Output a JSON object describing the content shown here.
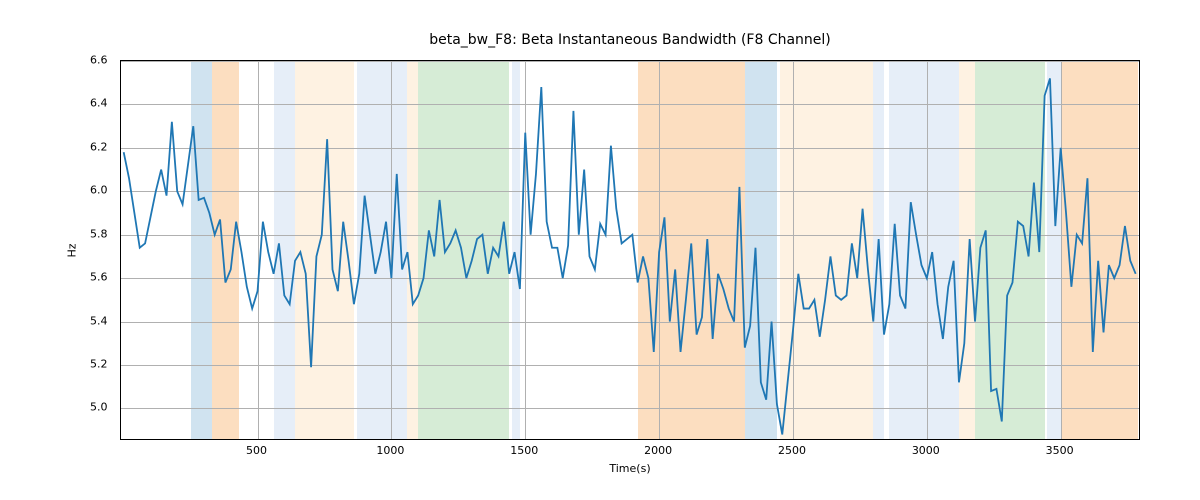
{
  "chart_data": {
    "type": "line",
    "title": "beta_bw_F8: Beta Instantaneous Bandwidth (F8 Channel)",
    "xlabel": "Time(s)",
    "ylabel": "Hz",
    "xlim": [
      -10,
      3800
    ],
    "ylim": [
      4.85,
      6.6
    ],
    "xticks": [
      500,
      1000,
      1500,
      2000,
      2500,
      3000,
      3500
    ],
    "yticks": [
      5.0,
      5.2,
      5.4,
      5.6,
      5.8,
      6.0,
      6.2,
      6.4,
      6.6
    ],
    "line_color": "#1f77b4",
    "bands": [
      {
        "x0": 250,
        "x1": 330,
        "color": "#d0e3f0"
      },
      {
        "x0": 330,
        "x1": 430,
        "color": "#fcdec0"
      },
      {
        "x0": 560,
        "x1": 640,
        "color": "#e6eef8"
      },
      {
        "x0": 640,
        "x1": 860,
        "color": "#fef2e2"
      },
      {
        "x0": 870,
        "x1": 1060,
        "color": "#e6eef8"
      },
      {
        "x0": 1060,
        "x1": 1100,
        "color": "#fef2e2"
      },
      {
        "x0": 1100,
        "x1": 1440,
        "color": "#d6ecd6"
      },
      {
        "x0": 1450,
        "x1": 1480,
        "color": "#e6eef8"
      },
      {
        "x0": 1920,
        "x1": 2320,
        "color": "#fcdec0"
      },
      {
        "x0": 2320,
        "x1": 2440,
        "color": "#d0e3f0"
      },
      {
        "x0": 2450,
        "x1": 2800,
        "color": "#fef2e2"
      },
      {
        "x0": 2800,
        "x1": 2840,
        "color": "#e6eef8"
      },
      {
        "x0": 2860,
        "x1": 3120,
        "color": "#e6eef8"
      },
      {
        "x0": 3120,
        "x1": 3180,
        "color": "#fef2e2"
      },
      {
        "x0": 3180,
        "x1": 3440,
        "color": "#d6ecd6"
      },
      {
        "x0": 3450,
        "x1": 3500,
        "color": "#e6eef8"
      },
      {
        "x0": 3500,
        "x1": 3790,
        "color": "#fcdec0"
      }
    ],
    "series": [
      {
        "name": "beta_bw_F8",
        "x_step": 20,
        "x_start": 0,
        "values": [
          6.18,
          6.06,
          5.9,
          5.74,
          5.76,
          5.88,
          6.0,
          6.1,
          5.98,
          6.32,
          6.0,
          5.94,
          6.12,
          6.3,
          5.96,
          5.97,
          5.9,
          5.8,
          5.87,
          5.58,
          5.64,
          5.86,
          5.72,
          5.56,
          5.46,
          5.54,
          5.86,
          5.72,
          5.62,
          5.76,
          5.52,
          5.48,
          5.68,
          5.72,
          5.62,
          5.19,
          5.7,
          5.8,
          6.24,
          5.64,
          5.54,
          5.86,
          5.68,
          5.48,
          5.62,
          5.98,
          5.8,
          5.62,
          5.72,
          5.86,
          5.6,
          6.08,
          5.64,
          5.72,
          5.48,
          5.52,
          5.6,
          5.82,
          5.7,
          5.96,
          5.72,
          5.76,
          5.82,
          5.74,
          5.6,
          5.68,
          5.78,
          5.8,
          5.62,
          5.74,
          5.7,
          5.86,
          5.62,
          5.72,
          5.55,
          6.27,
          5.8,
          6.08,
          6.48,
          5.86,
          5.74,
          5.74,
          5.6,
          5.75,
          6.37,
          5.8,
          6.1,
          5.7,
          5.64,
          5.85,
          5.8,
          6.21,
          5.92,
          5.76,
          5.78,
          5.8,
          5.58,
          5.7,
          5.6,
          5.26,
          5.72,
          5.88,
          5.4,
          5.64,
          5.26,
          5.5,
          5.76,
          5.34,
          5.42,
          5.78,
          5.32,
          5.62,
          5.55,
          5.46,
          5.4,
          6.02,
          5.28,
          5.38,
          5.74,
          5.12,
          5.04,
          5.4,
          5.02,
          4.88,
          5.12,
          5.36,
          5.62,
          5.46,
          5.46,
          5.5,
          5.33,
          5.5,
          5.7,
          5.52,
          5.5,
          5.52,
          5.76,
          5.6,
          5.92,
          5.64,
          5.4,
          5.78,
          5.34,
          5.48,
          5.85,
          5.52,
          5.46,
          5.95,
          5.8,
          5.66,
          5.6,
          5.72,
          5.48,
          5.32,
          5.56,
          5.68,
          5.12,
          5.3,
          5.78,
          5.4,
          5.74,
          5.82,
          5.08,
          5.09,
          4.94,
          5.52,
          5.58,
          5.86,
          5.84,
          5.7,
          6.04,
          5.72,
          6.44,
          6.52,
          5.84,
          6.2,
          5.9,
          5.56,
          5.8,
          5.76,
          6.06,
          5.26,
          5.68,
          5.35,
          5.66,
          5.6,
          5.66,
          5.84,
          5.68,
          5.62
        ]
      }
    ]
  }
}
